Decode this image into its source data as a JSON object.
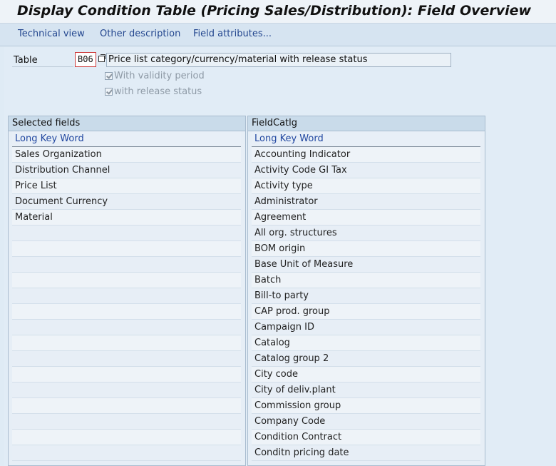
{
  "window": {
    "title": "Display Condition Table (Pricing Sales/Distribution): Field Overview"
  },
  "toolbar": {
    "buttons": [
      "Technical view",
      "Other description",
      "Field attributes..."
    ]
  },
  "table_section": {
    "label": "Table",
    "number": "B06",
    "description": "Price list category/currency/material with release status",
    "checkboxes": [
      {
        "label": "With validity period",
        "checked": true,
        "enabled": false
      },
      {
        "label": "with release status",
        "checked": true,
        "enabled": false
      }
    ]
  },
  "selected_fields": {
    "title": "Selected fields",
    "column_header": "Long Key Word",
    "rows": [
      "Sales Organization",
      "Distribution Channel",
      "Price List",
      "Document Currency",
      "Material",
      "",
      "",
      "",
      "",
      "",
      "",
      "",
      "",
      "",
      "",
      "",
      "",
      "",
      "",
      ""
    ]
  },
  "field_catalog": {
    "title": "FieldCatlg",
    "column_header": "Long Key Word",
    "rows": [
      "Accounting Indicator",
      "Activity Code GI Tax",
      "Activity type",
      "Administrator",
      "Agreement",
      "All org. structures",
      "BOM origin",
      "Base Unit of Measure",
      "Batch",
      "Bill-to party",
      "CAP prod. group",
      "Campaign ID",
      "Catalog",
      "Catalog group 2",
      "City code",
      "City of deliv.plant",
      "Commission group",
      "Company Code",
      "Condition Contract",
      "Conditn pricing date"
    ]
  }
}
